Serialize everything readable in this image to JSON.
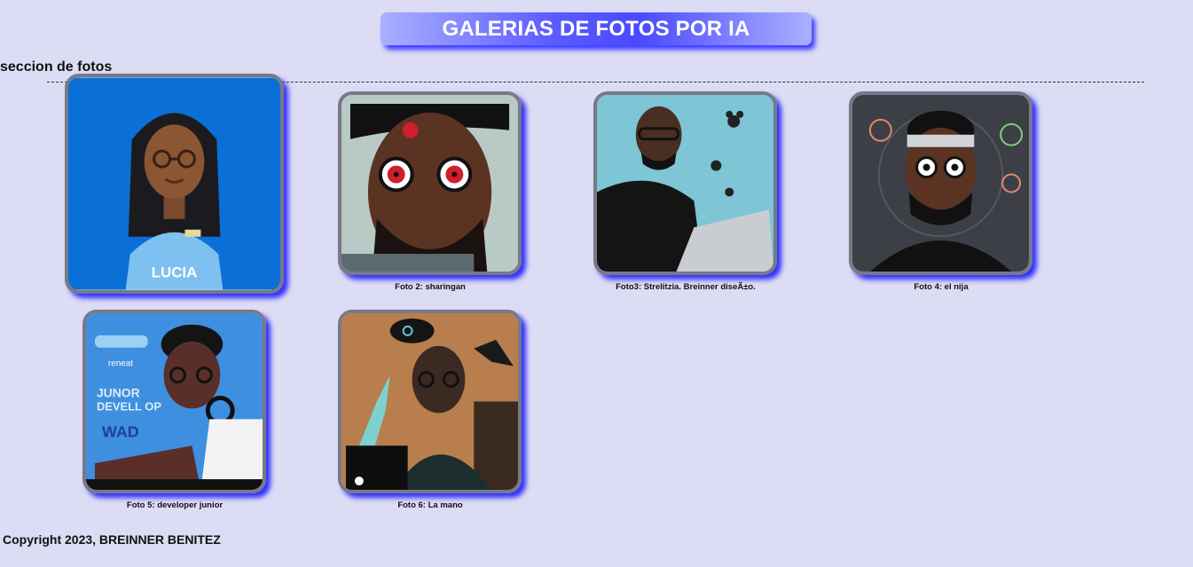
{
  "header": {
    "title": "GALERIAS DE FOTOS POR IA"
  },
  "section": {
    "heading": "seccion de fotos"
  },
  "gallery": {
    "items": [
      {
        "caption": "",
        "image_label": "LUCIA",
        "bg": "#0a6fd6"
      },
      {
        "caption": "Foto 2: sharingan",
        "bg": "#b9c9c6"
      },
      {
        "caption": "Foto3: Strelitzia. Breinner diseÃ±o.",
        "bg": "#7ec5d6"
      },
      {
        "caption": "Foto 4: el nija",
        "bg": "#3d3f47"
      },
      {
        "caption": "Foto 5: developer junior",
        "image_text": [
          "reneat",
          "JUNOR",
          "DEVELL OP",
          "WAD"
        ],
        "bg": "#3f8fe0"
      },
      {
        "caption": "Foto 6: La mano",
        "bg": "#b87e4d"
      }
    ]
  },
  "footer": {
    "text": "Copyright 2023, BREINNER BENITEZ"
  },
  "colors": {
    "page_bg": "#dcdcf4",
    "accent_shadow": "#2f2fff",
    "card_border": "#777a86"
  }
}
